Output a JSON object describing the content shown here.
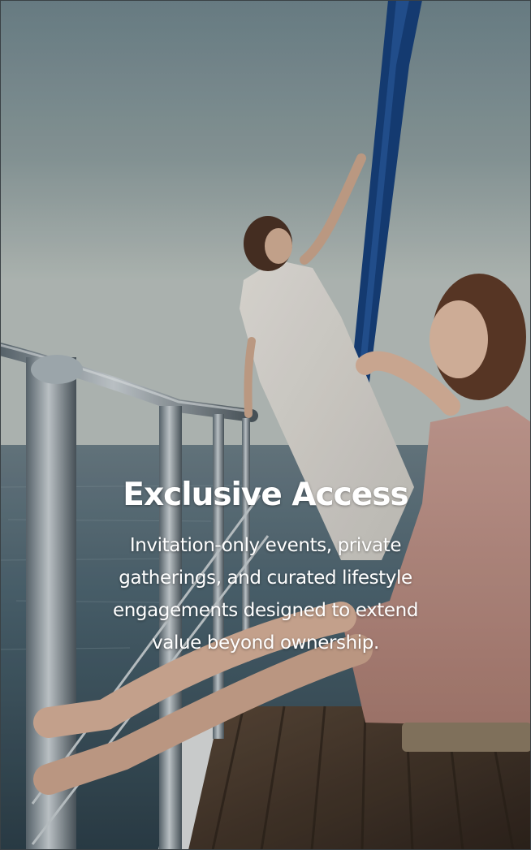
{
  "feature_card": {
    "title": "Exclusive Access",
    "description": "Invitation-only events, private gatherings, and curated lifestyle engagements designed to extend value beyond ownership.",
    "colors": {
      "text": "#ffffff",
      "sky_top": "#6f858d",
      "sky_bottom": "#b9c1bd",
      "sea": "#3d5460",
      "deck": "#4a3a2e"
    }
  }
}
